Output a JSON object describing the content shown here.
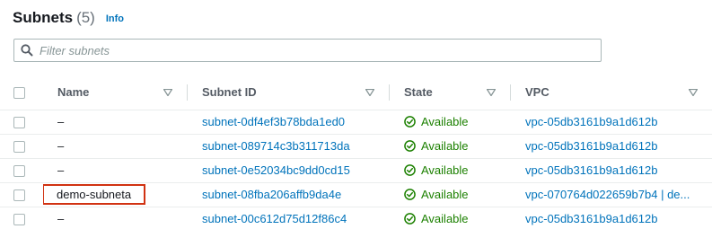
{
  "header": {
    "title": "Subnets",
    "count": "(5)",
    "info": "Info"
  },
  "filter": {
    "placeholder": "Filter subnets"
  },
  "columns": {
    "name": "Name",
    "subnet_id": "Subnet ID",
    "state": "State",
    "vpc": "VPC"
  },
  "rows": [
    {
      "name": "–",
      "subnet_id": "subnet-0df4ef3b78bda1ed0",
      "state": "Available",
      "vpc": "vpc-05db3161b9a1d612b"
    },
    {
      "name": "–",
      "subnet_id": "subnet-089714c3b311713da",
      "state": "Available",
      "vpc": "vpc-05db3161b9a1d612b"
    },
    {
      "name": "–",
      "subnet_id": "subnet-0e52034bc9dd0cd15",
      "state": "Available",
      "vpc": "vpc-05db3161b9a1d612b"
    },
    {
      "name": "demo-subneta",
      "subnet_id": "subnet-08fba206affb9da4e",
      "state": "Available",
      "vpc": "vpc-070764d022659b7b4 | de..."
    },
    {
      "name": "–",
      "subnet_id": "subnet-00c612d75d12f86c4",
      "state": "Available",
      "vpc": "vpc-05db3161b9a1d612b"
    }
  ],
  "colors": {
    "link": "#0073bb",
    "available": "#1d8102",
    "highlight": "#d13212"
  }
}
